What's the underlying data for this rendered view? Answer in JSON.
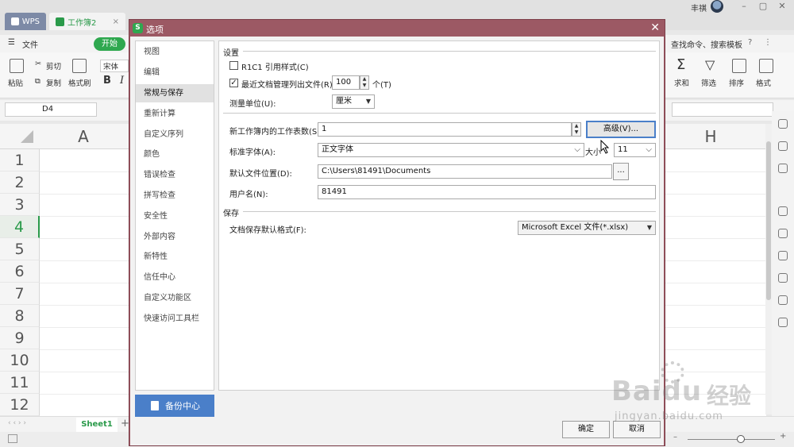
{
  "app": {
    "tabs": [
      {
        "label": "WPS"
      },
      {
        "label": "工作簿2"
      }
    ],
    "user": "丰祺",
    "menu": {
      "file": "文件",
      "start": "开始",
      "search": "查找命令、搜索模板"
    },
    "ribbon": {
      "font_name": "宋体",
      "cut": "剪切",
      "copy": "复制",
      "paste": "粘贴",
      "format_painter": "格式刷",
      "sum": "求和",
      "filter": "筛选",
      "sort": "排序",
      "format": "格式"
    },
    "name_box": "D4",
    "columns": [
      "A",
      "H"
    ],
    "rows": [
      "1",
      "2",
      "3",
      "4",
      "5",
      "6",
      "7",
      "8",
      "9",
      "10",
      "11",
      "12"
    ],
    "active_row": "4",
    "sheet_tab": "Sheet1"
  },
  "dialog": {
    "title": "选项",
    "nav": [
      "视图",
      "编辑",
      "常规与保存",
      "重新计算",
      "自定义序列",
      "颜色",
      "错误检查",
      "拼写检查",
      "安全性",
      "外部内容",
      "新特性",
      "信任中心",
      "自定义功能区",
      "快速访问工具栏"
    ],
    "nav_selected": "常规与保存",
    "backup_label": "备份中心",
    "settings_section": "设置",
    "r1c1_label": "R1C1 引用样式(C)",
    "recent_label": "最近文档管理列出文件(R):",
    "recent_value": "100",
    "recent_unit": "个(T)",
    "unit_label": "测量单位(U):",
    "unit_value": "厘米",
    "sheets_label": "新工作簿内的工作表数(S):",
    "sheets_value": "1",
    "advanced_button": "高级(V)...",
    "font_label": "标准字体(A):",
    "font_value": "正文字体",
    "size_label": "大小",
    "size_value": "11",
    "location_label": "默认文件位置(D):",
    "location_value": "C:\\Users\\81491\\Documents",
    "browse_button": "...",
    "username_label": "用户名(N):",
    "username_value": "81491",
    "save_section": "保存",
    "save_format_label": "文档保存默认格式(F):",
    "save_format_value": "Microsoft Excel 文件(*.xlsx)",
    "ok_button": "确定",
    "cancel_button": "取消"
  },
  "watermark": {
    "brand": "Baidu",
    "brand_cn": "经验",
    "url": "jingyan.baidu.com"
  }
}
